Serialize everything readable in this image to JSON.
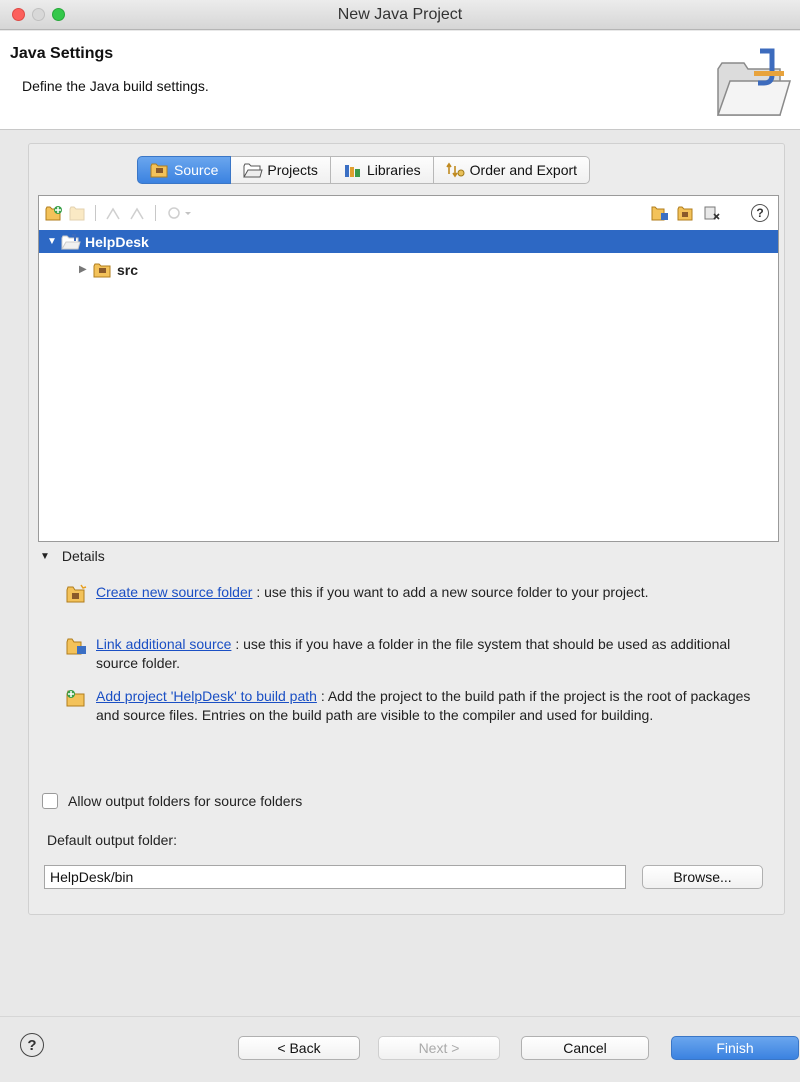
{
  "window": {
    "title": "New Java Project"
  },
  "header": {
    "title": "Java Settings",
    "description": "Define the Java build settings.",
    "icon": "java-project-folder-icon"
  },
  "tabs": [
    {
      "label": "Source",
      "icon": "source-folder-icon",
      "active": true
    },
    {
      "label": "Projects",
      "icon": "projects-folder-icon",
      "active": false
    },
    {
      "label": "Libraries",
      "icon": "libraries-icon",
      "active": false
    },
    {
      "label": "Order and Export",
      "icon": "order-export-icon",
      "active": false
    }
  ],
  "tree": {
    "items": [
      {
        "label": "HelpDesk",
        "expanded": true,
        "selected": true,
        "icon": "project-folder-icon"
      },
      {
        "label": "src",
        "expanded": false,
        "selected": false,
        "icon": "package-folder-icon"
      }
    ]
  },
  "details": {
    "label": "Details",
    "entries": [
      {
        "link": "Create new source folder",
        "text": ": use this if you want to add a new source folder to your project.",
        "icon": "new-source-folder-icon"
      },
      {
        "link": "Link additional source",
        "text": ": use this if you have a folder in the file system that should be used as additional source folder.",
        "icon": "link-source-icon"
      },
      {
        "link": "Add project 'HelpDesk' to build path",
        "text": ": Add the project to the build path if the project is the root of packages and source files. Entries on the build path are visible to the compiler and used for building.",
        "icon": "add-to-build-path-icon"
      }
    ]
  },
  "output": {
    "allow_label": "Allow output folders for source folders",
    "allow_checked": false,
    "default_label": "Default output folder:",
    "default_value": "HelpDesk/bin",
    "browse_label": "Browse..."
  },
  "footer": {
    "help": "?",
    "back": "< Back",
    "next": "Next >",
    "cancel": "Cancel",
    "finish": "Finish"
  },
  "colors": {
    "accent": "#3b82e0",
    "selection": "#2d68c4",
    "link": "#1a4fc4"
  }
}
